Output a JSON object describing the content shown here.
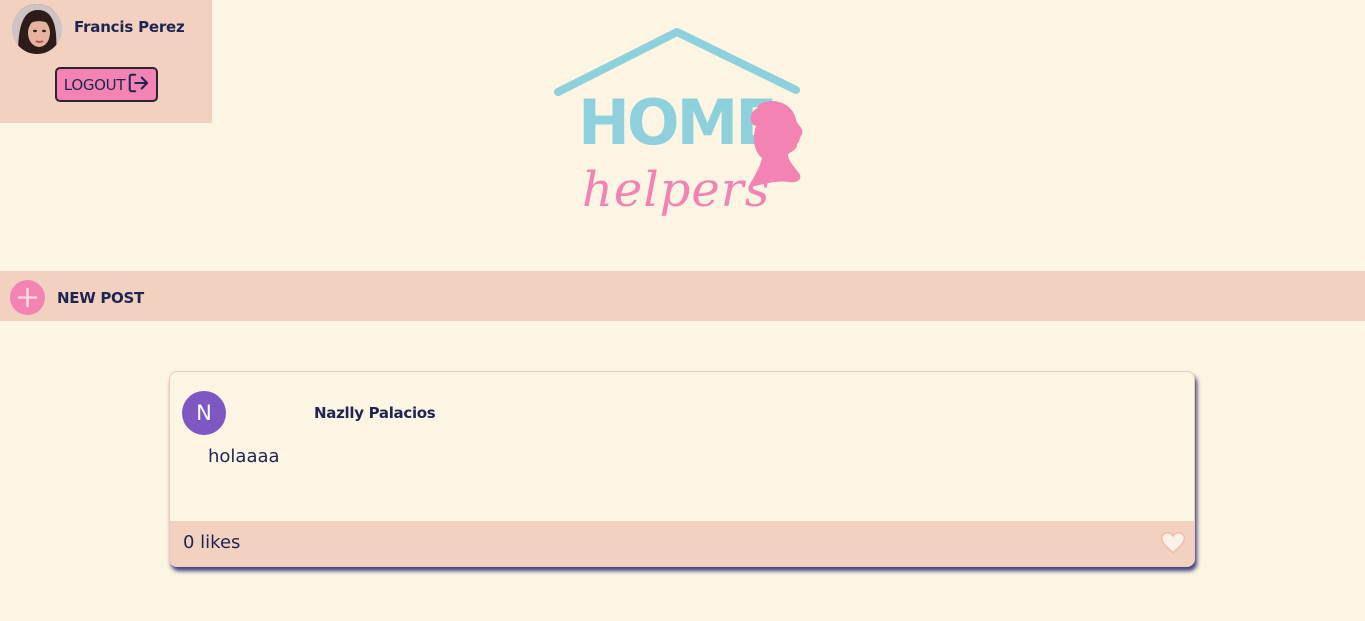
{
  "user": {
    "name": "Francis Perez",
    "logout_label": "LOGOUT"
  },
  "logo": {
    "word_top": "HOME",
    "word_bottom": "helpers"
  },
  "new_post": {
    "label": "NEW POST"
  },
  "posts": [
    {
      "avatar_letter": "N",
      "author": "Nazlly Palacios",
      "text": "holaaaa",
      "likes_text": "0 likes"
    }
  ],
  "colors": {
    "background": "#fdf5e4",
    "panel": "#f2d1c1",
    "pink": "#f283b3",
    "blue": "#8ed1dc",
    "navy": "#1f2552",
    "avatar_purple": "#7e57c2"
  }
}
